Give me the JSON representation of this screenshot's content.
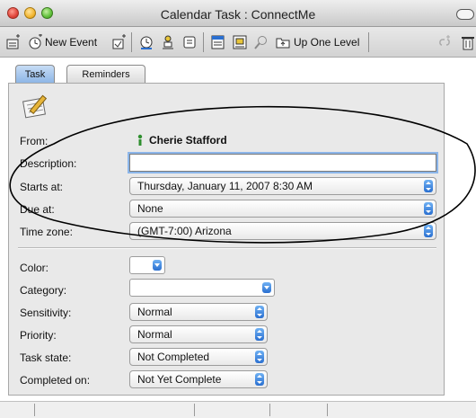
{
  "window": {
    "title": "Calendar Task : ConnectMe"
  },
  "toolbar": {
    "new_event_label": "New Event",
    "up_one_level_label": "Up One Level",
    "icons": [
      "new-note-icon",
      "new-event-icon",
      "new-task-icon",
      "schedule-icon",
      "person-icon",
      "address-card-icon",
      "calendar-icon",
      "print-icon",
      "search-icon",
      "folder-icon",
      "link-icon",
      "trash-icon"
    ]
  },
  "tabs": [
    {
      "label": "Task",
      "active": true
    },
    {
      "label": "Reminders",
      "active": false
    }
  ],
  "form": {
    "from_label": "From:",
    "from_value": "Cherie Stafford",
    "description_label": "Description:",
    "description_value": "",
    "starts_label": "Starts at:",
    "starts_value": "Thursday, January 11, 2007 8:30 AM",
    "due_label": "Due at:",
    "due_value": "None",
    "timezone_label": "Time zone:",
    "timezone_value": "(GMT-7:00) Arizona",
    "color_label": "Color:",
    "category_label": "Category:",
    "category_value": "",
    "sensitivity_label": "Sensitivity:",
    "sensitivity_value": "Normal",
    "priority_label": "Priority:",
    "priority_value": "Normal",
    "taskstate_label": "Task state:",
    "taskstate_value": "Not Completed",
    "completed_label": "Completed on:",
    "completed_value": "Not Yet Complete"
  },
  "colors": {
    "accent": "#3a7bd5",
    "tab_active": "#9cc0ec",
    "annotation": "#000000"
  }
}
